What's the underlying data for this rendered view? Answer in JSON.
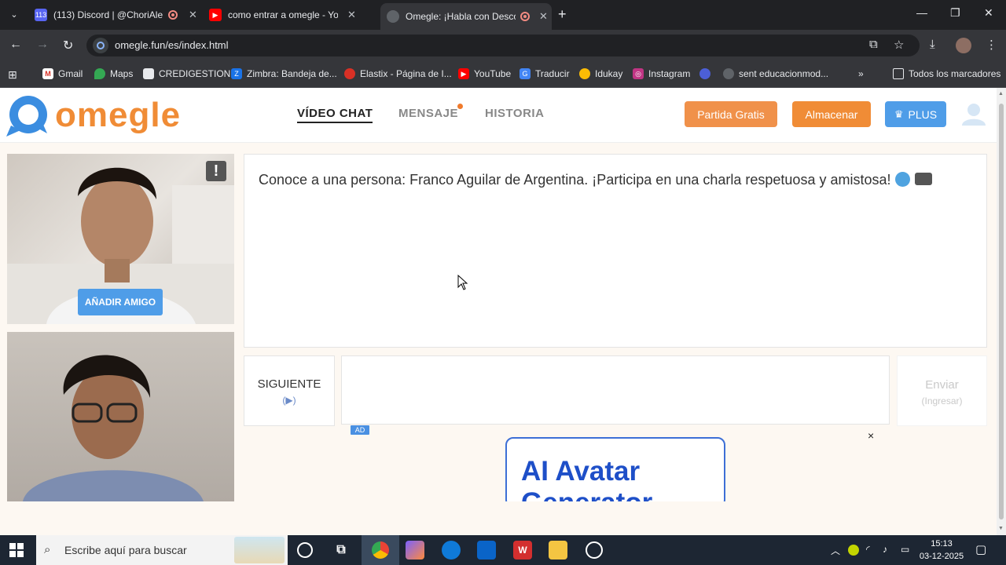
{
  "browser": {
    "tabs": [
      {
        "title": "(113) Discord | @ChoriAle",
        "badge": "113",
        "active": false
      },
      {
        "title": "como entrar a omegle - YouTube",
        "active": false
      },
      {
        "title": "Omegle: ¡Habla con Desconocidos!",
        "active": true
      }
    ],
    "url": "omegle.fun/es/index.html",
    "bookmarks": [
      "Gmail",
      "Maps",
      "CREDIGESTION",
      "Zimbra: Bandeja de...",
      "Elastix - Página de I...",
      "YouTube",
      "Traducir",
      "Idukay",
      "Instagram",
      "sent educacionmod...",
      "Todos los marcadores"
    ]
  },
  "site": {
    "logo": "omegle",
    "nav": [
      "VÍDEO CHAT",
      "MENSAJE",
      "HISTORIA"
    ],
    "buttons": {
      "free": "Partida Gratis",
      "store": "Almacenar",
      "plus": "PLUS"
    },
    "colors": {
      "brand_orange": "#f08c36",
      "plus_blue": "#4f9de8"
    }
  },
  "videos": {
    "add_friend": "AÑADIR AMIGO",
    "report": "!"
  },
  "chat": {
    "message": "Conoce a una persona: Franco Aguilar de Argentina. ¡Participa en una charla respetuosa y amistosa!",
    "next_label": "SIGUIENTE",
    "next_hint": "(▶)",
    "send_label": "Enviar",
    "send_hint": "(Ingresar)"
  },
  "ad": {
    "badge": "AD",
    "close": "×",
    "title": "AI Avatar",
    "title_line2": "Generator"
  },
  "taskbar": {
    "search_placeholder": "Escribe aquí para buscar",
    "time": "15:13",
    "date": "03-12-2025"
  }
}
